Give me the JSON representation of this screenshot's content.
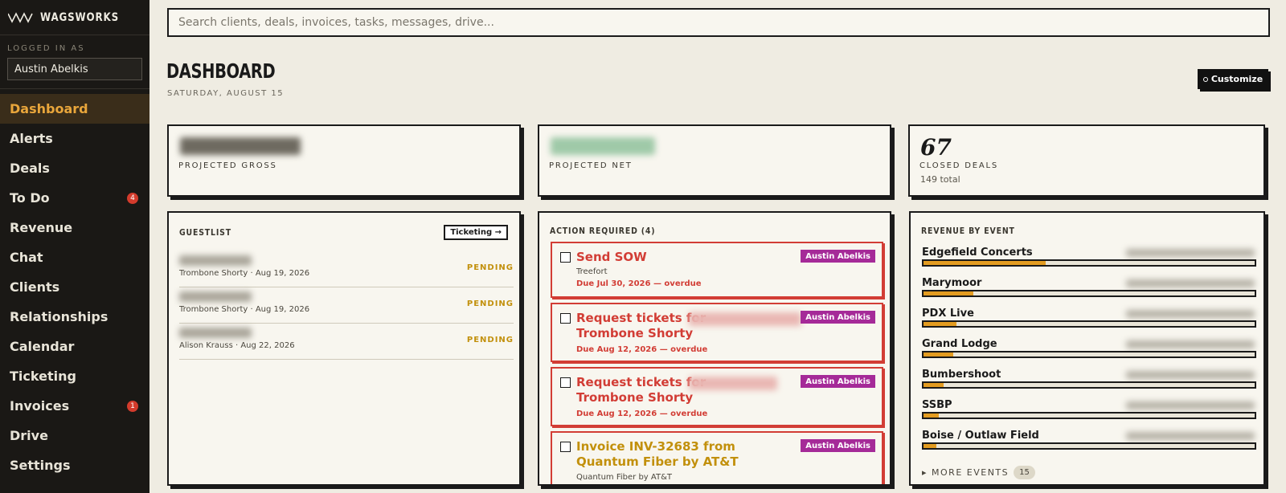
{
  "brand": {
    "name": "WAGSWORKS"
  },
  "user": {
    "label": "LOGGED IN AS",
    "name": "Austin Abelkis"
  },
  "nav": [
    {
      "label": "Dashboard",
      "active": true
    },
    {
      "label": "Alerts"
    },
    {
      "label": "Deals"
    },
    {
      "label": "To Do",
      "badge": "4"
    },
    {
      "label": "Revenue"
    },
    {
      "label": "Chat"
    },
    {
      "label": "Clients"
    },
    {
      "label": "Relationships"
    },
    {
      "label": "Calendar"
    },
    {
      "label": "Ticketing"
    },
    {
      "label": "Invoices",
      "badge": "1"
    },
    {
      "label": "Drive"
    },
    {
      "label": "Settings"
    }
  ],
  "search": {
    "placeholder": "Search clients, deals, invoices, tasks, messages, drive..."
  },
  "header": {
    "title": "DASHBOARD",
    "date": "SATURDAY, AUGUST 15",
    "customize_label": "Customize"
  },
  "stats": {
    "projected_gross": {
      "label": "PROJECTED GROSS"
    },
    "projected_net": {
      "label": "PROJECTED NET"
    },
    "closed_deals": {
      "value": "67",
      "label": "CLOSED DEALS",
      "sub": "149 total"
    }
  },
  "guestlist": {
    "title": "GUESTLIST",
    "button": "Ticketing →",
    "rows": [
      {
        "meta": "Trombone Shorty · Aug 19, 2026",
        "status": "PENDING"
      },
      {
        "meta": "Trombone Shorty · Aug 19, 2026",
        "status": "PENDING"
      },
      {
        "meta": "Alison Krauss · Aug 22, 2026",
        "status": "PENDING"
      }
    ]
  },
  "actions": {
    "title": "ACTION REQUIRED (4)",
    "items": [
      {
        "title": "Send SOW",
        "sub": "Treefort",
        "due": "Due Jul 30, 2026 — overdue",
        "owner": "Austin Abelkis"
      },
      {
        "title": "Request tickets for\nTrombone Shorty",
        "due": "Due Aug 12, 2026 — overdue",
        "owner": "Austin Abelkis"
      },
      {
        "title": "Request tickets for\nTrombone Shorty",
        "due": "Due Aug 12, 2026 — overdue",
        "owner": "Austin Abelkis"
      },
      {
        "title": "Invoice INV-32683 from Quantum Fiber by AT&T",
        "sub": "Quantum Fiber by AT&T",
        "owner": "Austin Abelkis"
      }
    ]
  },
  "revenue": {
    "title": "REVENUE BY EVENT",
    "events": [
      {
        "name": "Edgefield Concerts",
        "share": 0.37
      },
      {
        "name": "Marymoor",
        "share": 0.15
      },
      {
        "name": "PDX Live",
        "share": 0.1
      },
      {
        "name": "Grand Lodge",
        "share": 0.09
      },
      {
        "name": "Bumbershoot",
        "share": 0.06
      },
      {
        "name": "SSBP",
        "share": 0.045
      },
      {
        "name": "Boise / Outlaw Field",
        "share": 0.04
      }
    ],
    "more_label": "MORE EVENTS",
    "more_count": "15"
  },
  "colors": {
    "accent": "#e9a63b",
    "danger": "#d23d35",
    "owner": "#a52a98",
    "pending": "#c2900c"
  }
}
